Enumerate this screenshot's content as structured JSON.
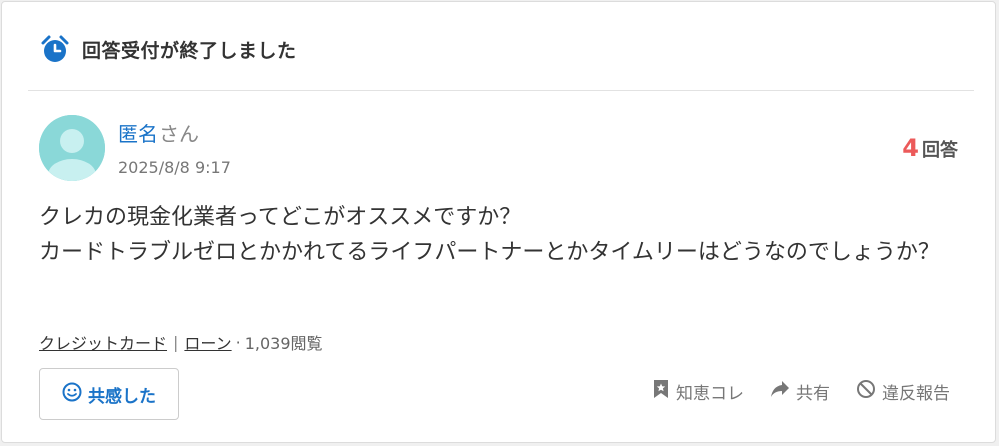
{
  "status": {
    "icon": "alarm-clock-icon",
    "label": "回答受付が終了しました"
  },
  "post": {
    "author_name": "匿名",
    "author_suffix": "さん",
    "date": "2025/8/8 9:17",
    "answers_count": "4",
    "answers_unit": "回答",
    "question_lines": [
      "クレカの現金化業者ってどこがオススメですか？",
      "カードトラブルゼロとかかれてるライフパートナーとかタイムリーはどうなのでしょうか？"
    ]
  },
  "tags": {
    "items": [
      "クレジットカード",
      "ローン"
    ],
    "separator": "|",
    "views": "1,039閲覧"
  },
  "actions": {
    "empathy_label": "共感した",
    "chie_kore": "知恵コレ",
    "share": "共有",
    "report": "違反報告"
  },
  "colors": {
    "accent_blue": "#1a73c8",
    "count_red": "#ec5a5a",
    "avatar_teal": "#8ad8d8"
  }
}
